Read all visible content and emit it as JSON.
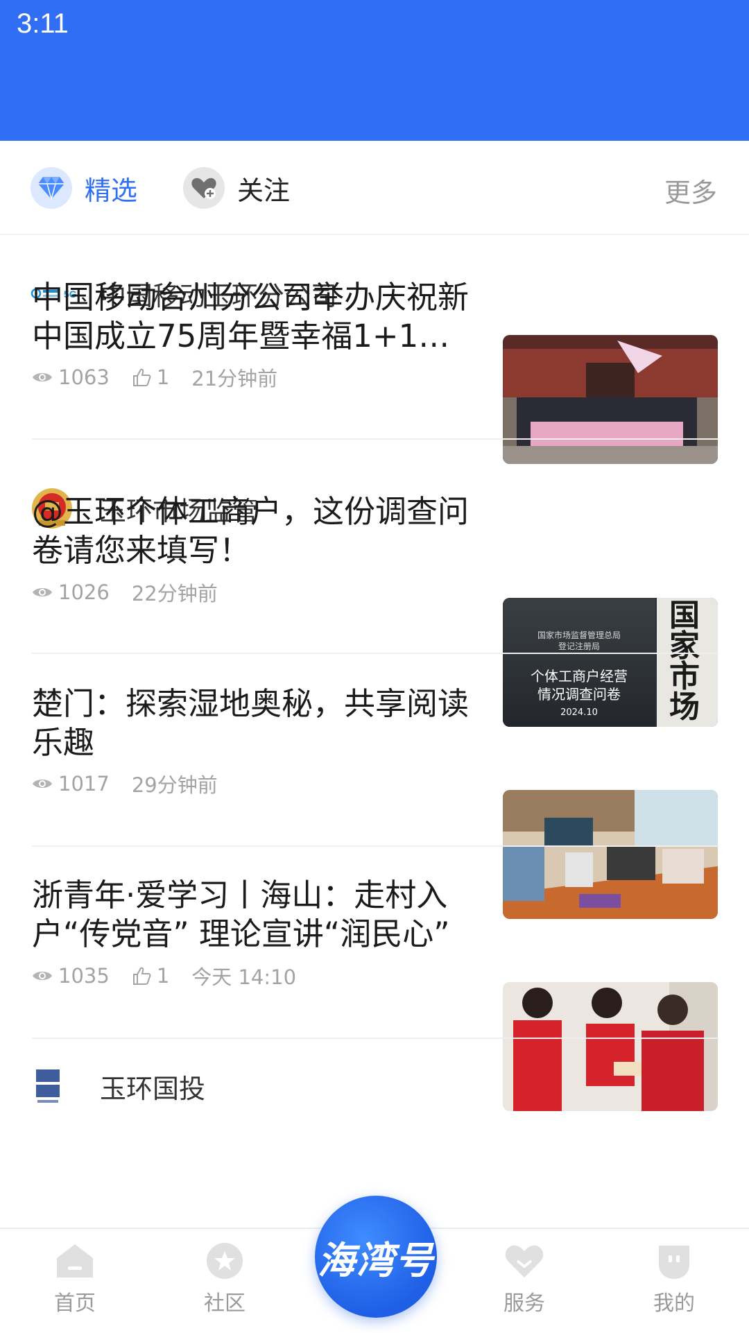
{
  "status_bar": {
    "time": "3:11"
  },
  "tabs": {
    "featured": "精选",
    "follow": "关注",
    "more": "更多"
  },
  "feed": [
    {
      "source": "中国移动玉环分公司",
      "logo_text": "中国移动 5G",
      "title": "中国移动台州分公司举办庆祝新中国成立75周年暨幸福1+1…",
      "views": "1063",
      "likes": "1",
      "time": "21分钟前"
    },
    {
      "source": "玉环市场监管",
      "title": "@玉环个体工商户，这份调查问卷请您来填写！",
      "views": "1026",
      "time": "22分钟前",
      "thumb_text": {
        "agency_line1": "国家市场监督管理总局",
        "agency_line2": "登记注册局",
        "headline1": "个体工商户经营",
        "headline2": "情况调查问卷",
        "date": "2024.10",
        "sign": "国家市场"
      }
    },
    {
      "title": "楚门：探索湿地奥秘，共享阅读乐趣",
      "views": "1017",
      "time": "29分钟前"
    },
    {
      "title": "浙青年·爱学习丨海山：走村入户“传党音” 理论宣讲“润民心”",
      "views": "1035",
      "likes": "1",
      "time": "今天 14:10"
    },
    {
      "source": "玉环国投",
      "logo_text": "玉环国投"
    }
  ],
  "bottom_nav": {
    "home": "首页",
    "community": "社区",
    "center": "海湾号",
    "service": "服务",
    "mine": "我的"
  },
  "colors": {
    "brand_blue": "#2f6ef5",
    "muted_gray": "#9a9a9a"
  }
}
